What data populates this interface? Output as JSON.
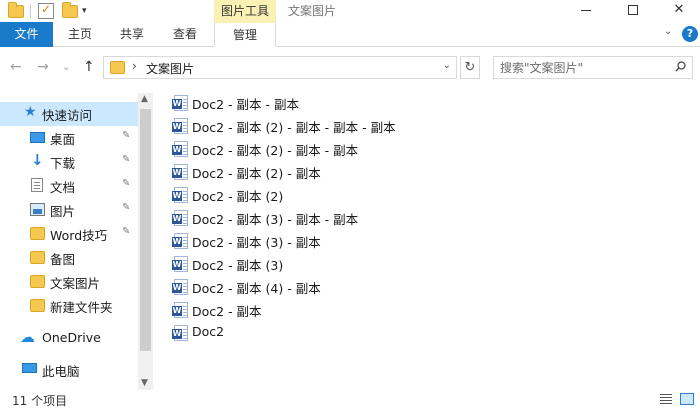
{
  "quick_access_toolbar": {
    "dropdown": "▾"
  },
  "title_bar": {
    "context_tab_title": "图片工具",
    "window_title": "文案图片",
    "minimize": "—",
    "maximize": "□",
    "close": "✕"
  },
  "ribbon": {
    "file_tab": "文件",
    "tabs": [
      "主页",
      "共享",
      "查看",
      "管理"
    ],
    "expand_icon": "⌄",
    "help": "?"
  },
  "address_bar": {
    "back": "←",
    "forward": "→",
    "recent": "⌄",
    "up": "↑",
    "separator": "›",
    "path": "文案图片",
    "dropdown": "⌄",
    "refresh": "↻"
  },
  "search": {
    "placeholder": "搜索\"文案图片\""
  },
  "nav_pane": {
    "quick_access": "快速访问",
    "items": [
      {
        "label": "桌面",
        "icon": "desktop-icon",
        "pinned": true
      },
      {
        "label": "下载",
        "icon": "download-icon",
        "pinned": true
      },
      {
        "label": "文档",
        "icon": "document-icon",
        "pinned": true
      },
      {
        "label": "图片",
        "icon": "pictures-icon",
        "pinned": true
      },
      {
        "label": "Word技巧",
        "icon": "folder-icon",
        "pinned": true
      },
      {
        "label": "备图",
        "icon": "folder-icon",
        "pinned": false
      },
      {
        "label": "文案图片",
        "icon": "folder-icon",
        "pinned": false
      },
      {
        "label": "新建文件夹",
        "icon": "folder-icon",
        "pinned": false
      }
    ],
    "onedrive": "OneDrive",
    "this_pc": "此电脑",
    "pin_glyph": "📌"
  },
  "files": [
    "Doc2 - 副本 - 副本",
    "Doc2 - 副本 (2) - 副本 - 副本 - 副本",
    "Doc2 - 副本 (2) - 副本 - 副本",
    "Doc2 - 副本 (2) - 副本",
    "Doc2 - 副本 (2)",
    "Doc2 - 副本 (3) - 副本 - 副本",
    "Doc2 - 副本 (3) - 副本",
    "Doc2 - 副本 (3)",
    "Doc2 - 副本 (4) - 副本",
    "Doc2 - 副本",
    "Doc2"
  ],
  "status_bar": {
    "item_count": "11 个项目"
  },
  "colors": {
    "accent": "#1979ca",
    "context_tab": "#fbf1b5",
    "selection": "#cce8ff"
  }
}
